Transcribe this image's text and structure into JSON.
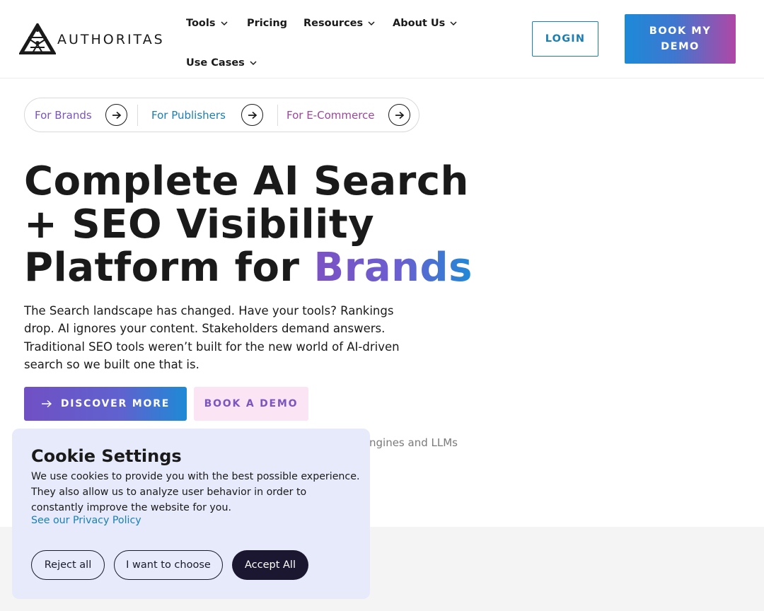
{
  "header": {
    "brand": "AUTHORITAS",
    "nav": [
      {
        "label": "Tools",
        "has_dropdown": true
      },
      {
        "label": "Pricing",
        "has_dropdown": false
      },
      {
        "label": "Resources",
        "has_dropdown": true
      },
      {
        "label": "About Us",
        "has_dropdown": true
      },
      {
        "label": "Use Cases",
        "has_dropdown": true
      }
    ],
    "login_label": "LOGIN",
    "book_demo_line1": "BOOK MY",
    "book_demo_line2": "DEMO"
  },
  "audience": [
    {
      "label": "For Brands",
      "color": "#7a55c0"
    },
    {
      "label": "For Publishers",
      "color": "#1a7fb5"
    },
    {
      "label": "For E-Commerce",
      "color": "#a0459e"
    }
  ],
  "hero": {
    "title_line1": "Complete AI Search",
    "title_line2": "+ SEO Visibility",
    "title_line3_prefix": "Platform for ",
    "title_accent": "Brands",
    "description": "The Search landscape has changed. Have your tools? Rankings drop. AI ignores your content. Stakeholders demand answers. Traditional SEO tools weren’t built for the new world of AI-driven search so we built one that is.",
    "discover_label": "DISCOVER MORE",
    "book_demo_label": "BOOK A DEMO",
    "subline_visible": "ngines and LLMs"
  },
  "cookie": {
    "title": "Cookie Settings",
    "text": "We use cookies to provide you with the best possible experience. They also allow us to analyze user behavior in order to constantly improve the website for you.",
    "privacy_link": "See our Privacy Policy",
    "reject_label": "Reject all",
    "choose_label": "I want to choose",
    "accept_label": "Accept All"
  },
  "colors": {
    "accent_blue": "#1a7fb5",
    "accent_purple": "#7a55c0",
    "accent_magenta": "#a0459e",
    "cookie_bg": "#e6eafa",
    "accept_bg": "#1c1730"
  },
  "icons": {
    "logo": "authoritas-triangle-logo",
    "dropdown": "chevron-down-icon",
    "arrow": "arrow-right-icon"
  }
}
